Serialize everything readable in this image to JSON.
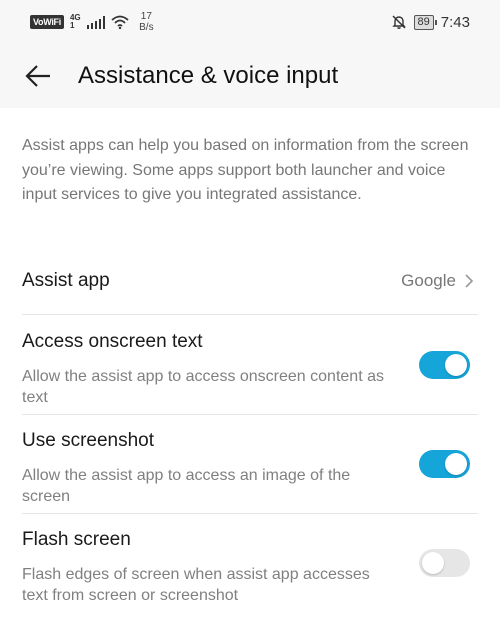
{
  "status_bar": {
    "vowifi": "VoWiFi",
    "network": "4G",
    "network_sub": "1",
    "speed_value": "17",
    "speed_unit": "B/s",
    "battery": "89",
    "time": "7:43"
  },
  "header": {
    "title": "Assistance & voice input"
  },
  "description": "Assist apps can help you based on information from the screen you’re viewing. Some apps support both launcher and voice input services to give you integrated assistance.",
  "assist_app": {
    "label": "Assist app",
    "value": "Google"
  },
  "settings": [
    {
      "title": "Access onscreen text",
      "subtitle": "Allow the assist app to access onscreen content as text",
      "enabled": true
    },
    {
      "title": "Use screenshot",
      "subtitle": "Allow the assist app to access an image of the screen",
      "enabled": true
    },
    {
      "title": "Flash screen",
      "subtitle": "Flash edges of screen when assist app accesses text from screen or screenshot",
      "enabled": false
    }
  ],
  "colors": {
    "accent": "#16a5d8",
    "toggle_off": "#e6e6e6"
  }
}
